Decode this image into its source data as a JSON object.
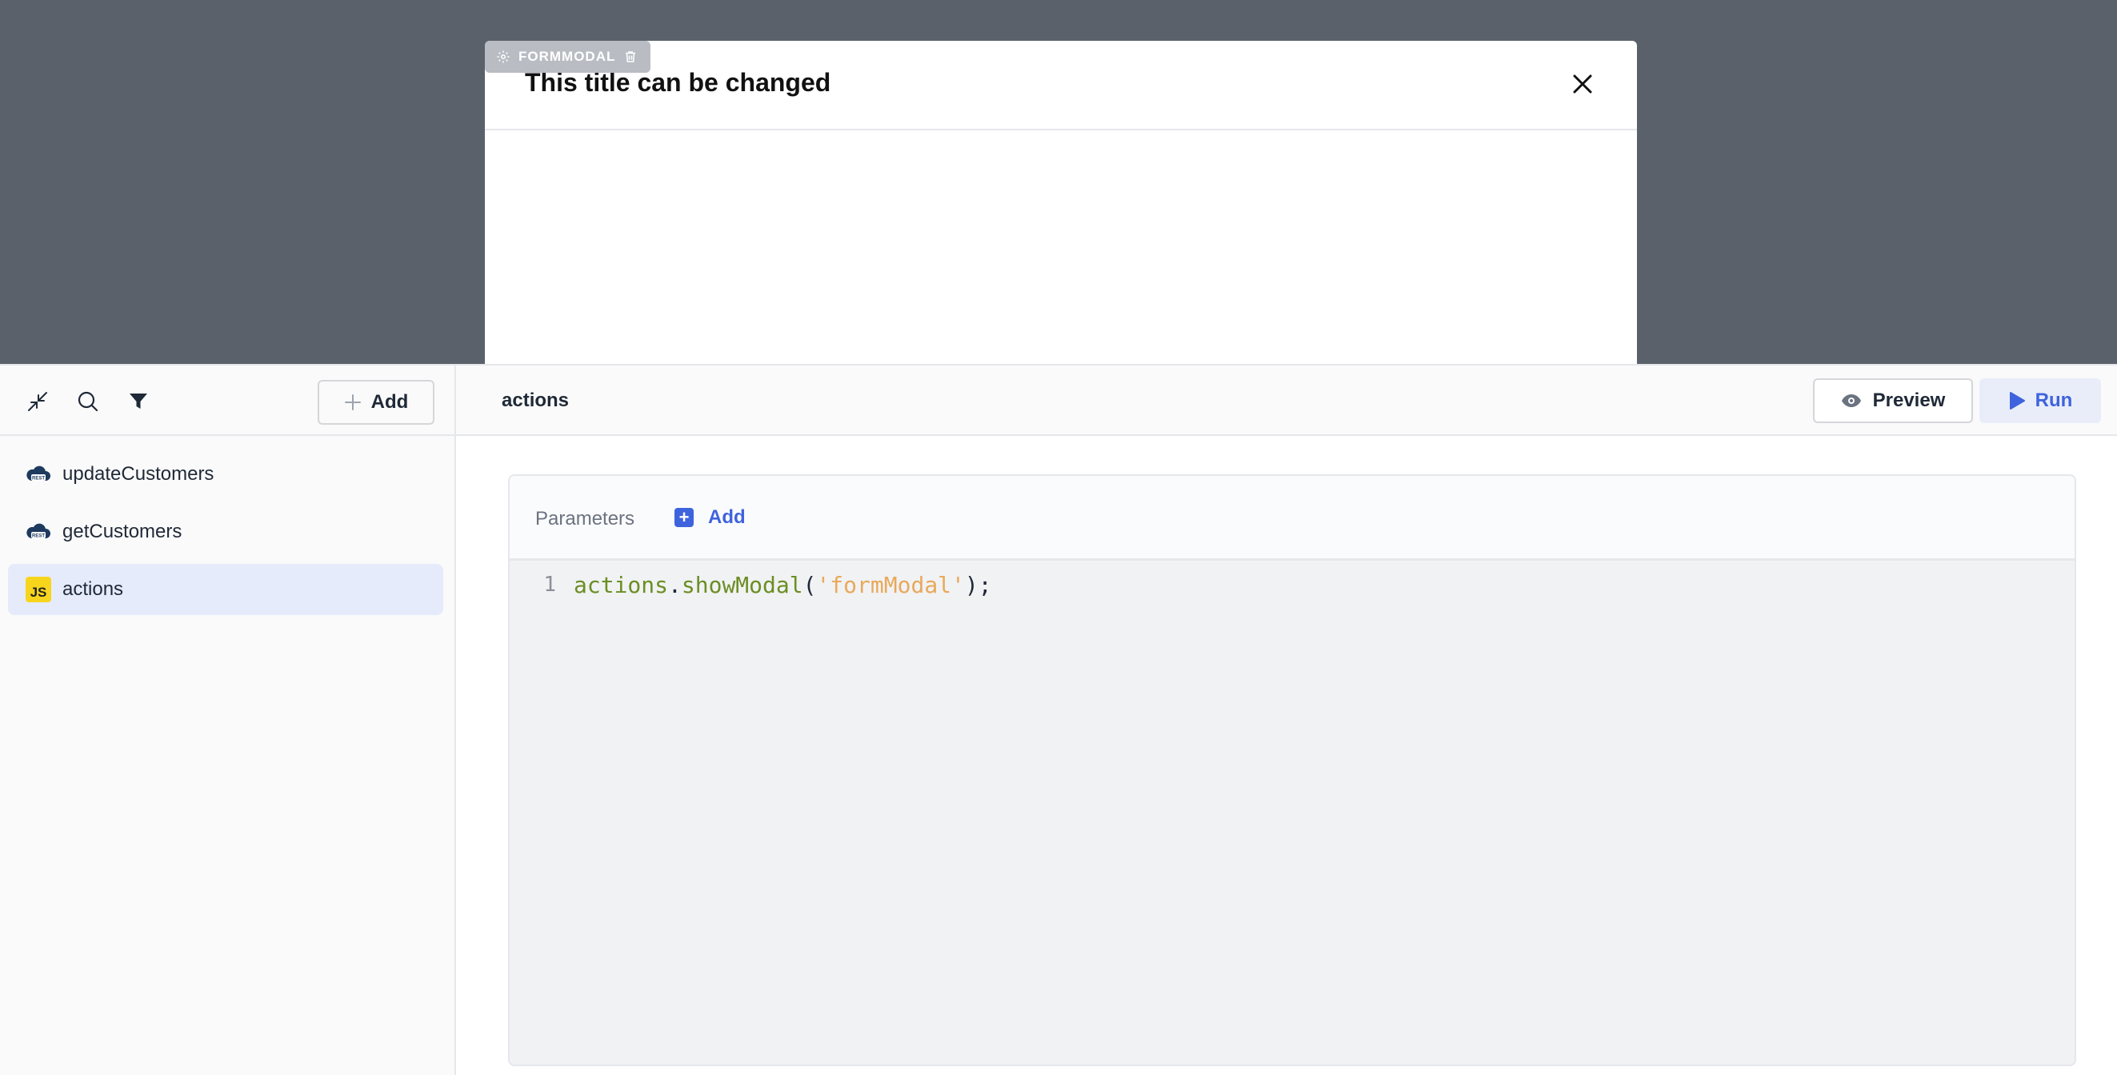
{
  "canvas": {
    "widget_tag": {
      "label": "FORMMODAL",
      "icons": [
        "gear-icon",
        "trash-icon"
      ]
    },
    "modal": {
      "title": "This title can be changed",
      "close_icon": "close-icon"
    }
  },
  "sidebar": {
    "toolbar": {
      "icons": [
        "collapse-icon",
        "search-icon",
        "filter-icon"
      ],
      "add_label": "Add"
    },
    "queries": [
      {
        "name": "updateCustomers",
        "icon": "rest-api-icon",
        "active": false
      },
      {
        "name": "getCustomers",
        "icon": "rest-api-icon",
        "active": false
      },
      {
        "name": "actions",
        "icon": "js-icon",
        "badge": "JS",
        "active": true
      }
    ]
  },
  "main": {
    "query_name": "actions",
    "preview_label": "Preview",
    "run_label": "Run",
    "parameters_label": "Parameters",
    "parameters_add_label": "Add",
    "code": {
      "line_number": "1",
      "tokens": {
        "obj": "actions",
        "dot": ".",
        "method": "showModal",
        "open": "(",
        "arg": "'formModal'",
        "close": ");"
      }
    }
  },
  "colors": {
    "canvas_bg": "#5a616b",
    "accent": "#3e63dd",
    "active_item_bg": "#e6ebfb",
    "js_badge": "#f7d51d",
    "code_identifier": "#6b8e23",
    "code_string": "#e8a95a"
  }
}
